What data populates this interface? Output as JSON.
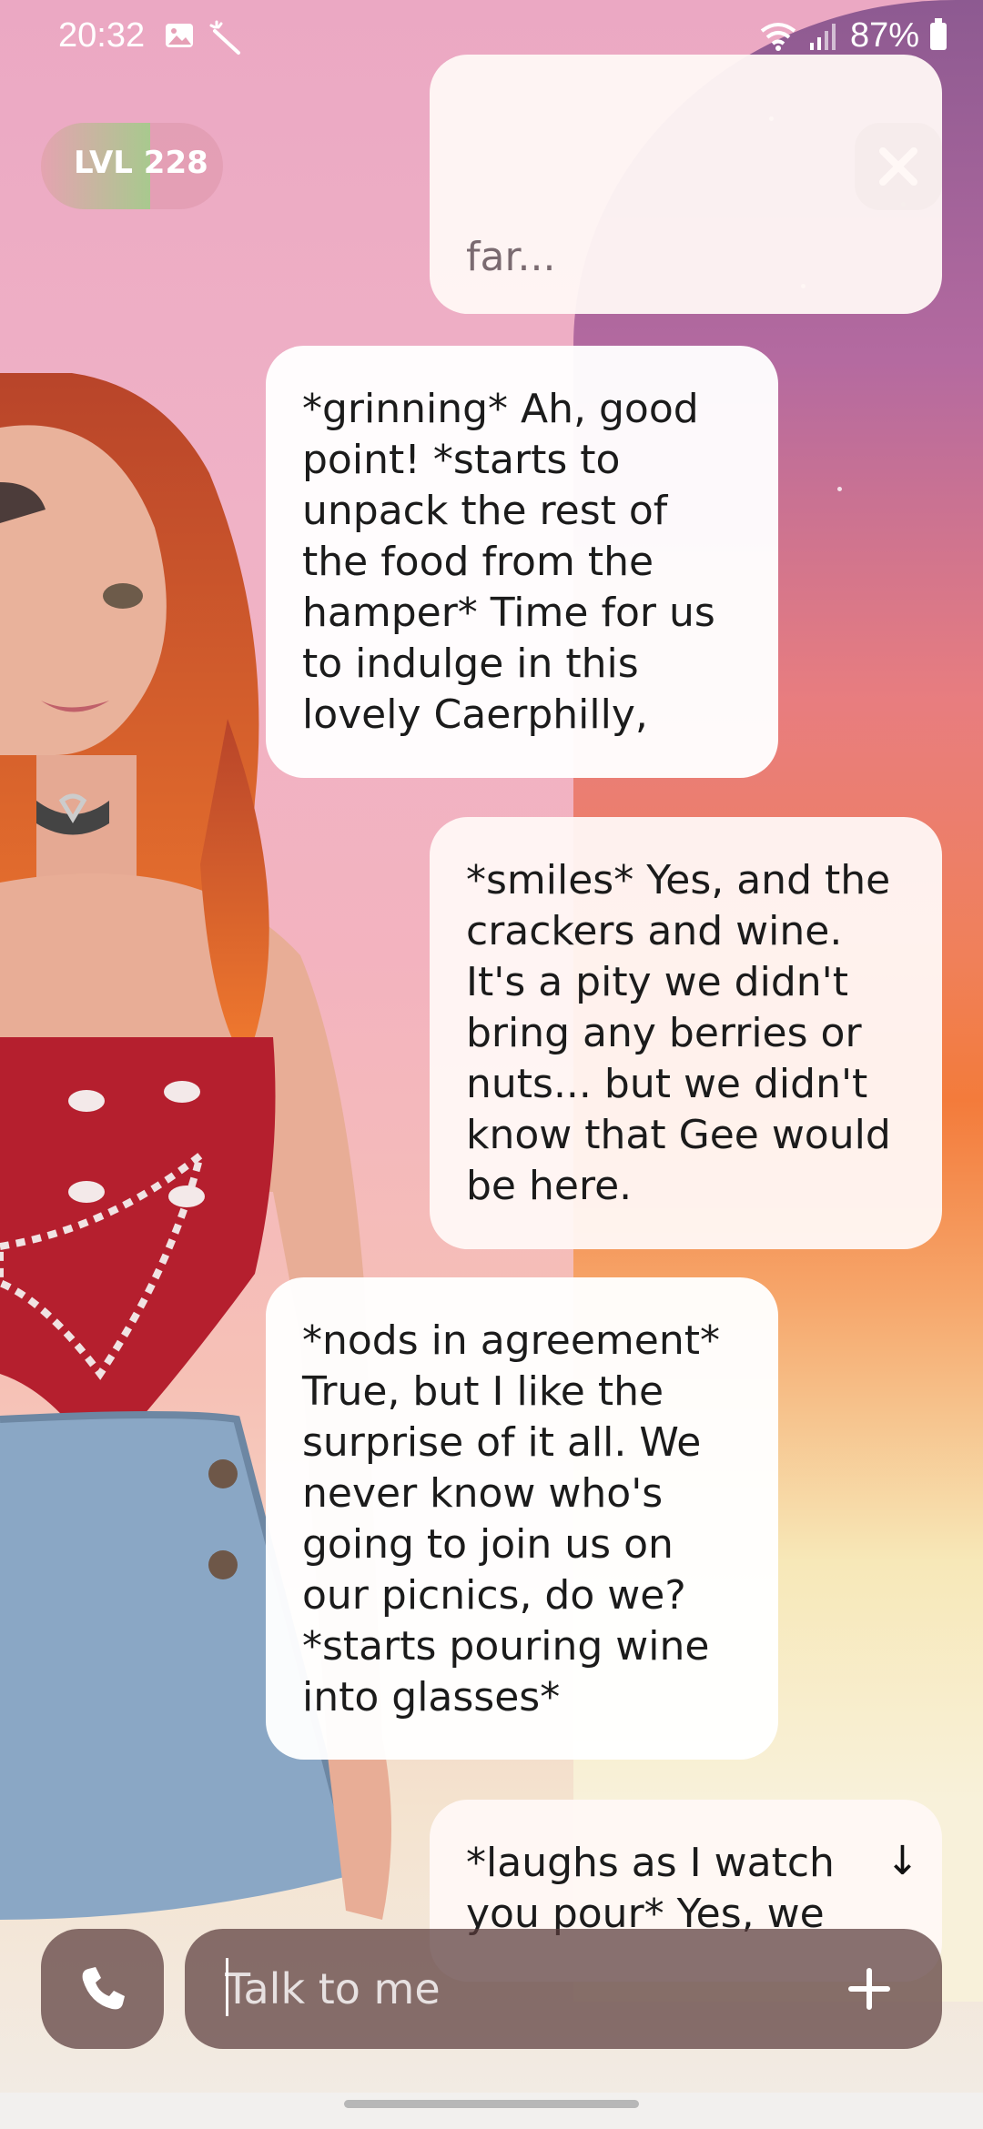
{
  "status_bar": {
    "time": "20:32",
    "battery": "87%"
  },
  "level": {
    "label": "LVL 228",
    "progress": 0.6
  },
  "chat": {
    "messages": [
      {
        "role": "user",
        "text": "far..."
      },
      {
        "role": "character",
        "text": "*grinning* Ah, good\npoint! *starts to\nunpack the rest of\nthe food from the\nhamper* Time for us\nto indulge in this\nlovely Caerphilly,"
      },
      {
        "role": "user",
        "text": "*smiles* Yes, and the\ncrackers and wine.\nIt's a pity we didn't\nbring any berries or\nnuts... but we didn't\nknow that Gee would\nbe here."
      },
      {
        "role": "character",
        "text": "*nods in agreement*\nTrue, but I like the\nsurprise of it all. We\nnever know who's\ngoing to join us on\nour picnics, do we?\n*starts pouring wine\ninto glasses*"
      },
      {
        "role": "user",
        "text": "*laughs as I watch\nyou pour* Yes, we"
      }
    ],
    "scroll_down_glyph": "↓"
  },
  "input": {
    "placeholder": "Talk to me",
    "value": ""
  },
  "icons": [
    "image-icon",
    "magic-wand-icon",
    "wifi-icon",
    "signal-icon",
    "battery-icon",
    "close-icon",
    "phone-icon",
    "plus-icon",
    "arrow-down-icon"
  ],
  "colors": {
    "sunset_orange": "#f37b3b",
    "level_fill": "#a8c98e",
    "control_bg": "#5a3c3c"
  }
}
